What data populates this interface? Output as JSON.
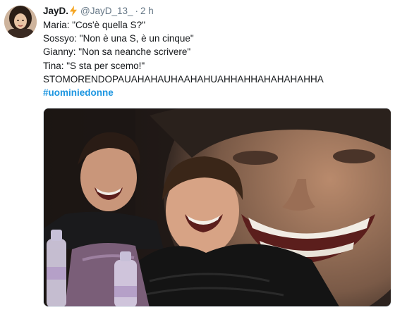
{
  "tweet": {
    "display_name": "JayD.",
    "handle": "@JayD_13_",
    "separator": "·",
    "timestamp": "2 h",
    "lines": [
      "Maria: \"Cos'è quella S?\"",
      "Sossyo: \"Non è una S, è un cinque\"",
      "Gianny: \"Non sa neanche scrivere\"",
      "Tina: \"S sta per scemo!\"",
      "STOMORENDOPAUAHAHAUHAAHAHUAHHAHHAHAHAHAHHA"
    ],
    "hashtag": "#uominiedonne"
  },
  "icons": {
    "verified_badge": "lightning-bolt-icon"
  },
  "colors": {
    "name": "#14171a",
    "muted": "#657786",
    "hashtag": "#1b95e0",
    "bolt": "#f5a623"
  }
}
